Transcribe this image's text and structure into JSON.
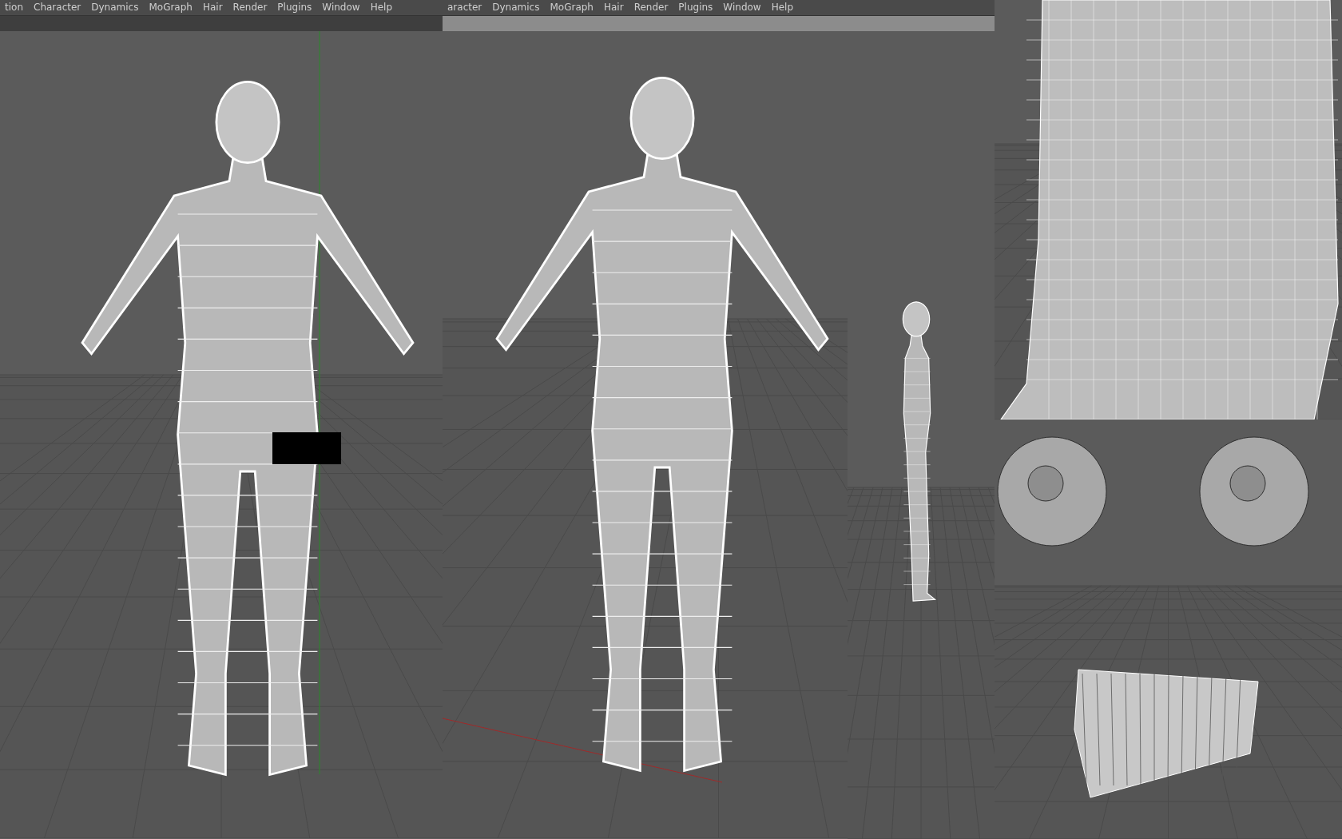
{
  "menu_bars": [
    {
      "items": [
        "tion",
        "Character",
        "Dynamics",
        "MoGraph",
        "Hair",
        "Render",
        "Plugins",
        "Window",
        "Help"
      ]
    },
    {
      "items": [
        "aracter",
        "Dynamics",
        "MoGraph",
        "Hair",
        "Render",
        "Plugins",
        "Window",
        "Help"
      ]
    }
  ]
}
